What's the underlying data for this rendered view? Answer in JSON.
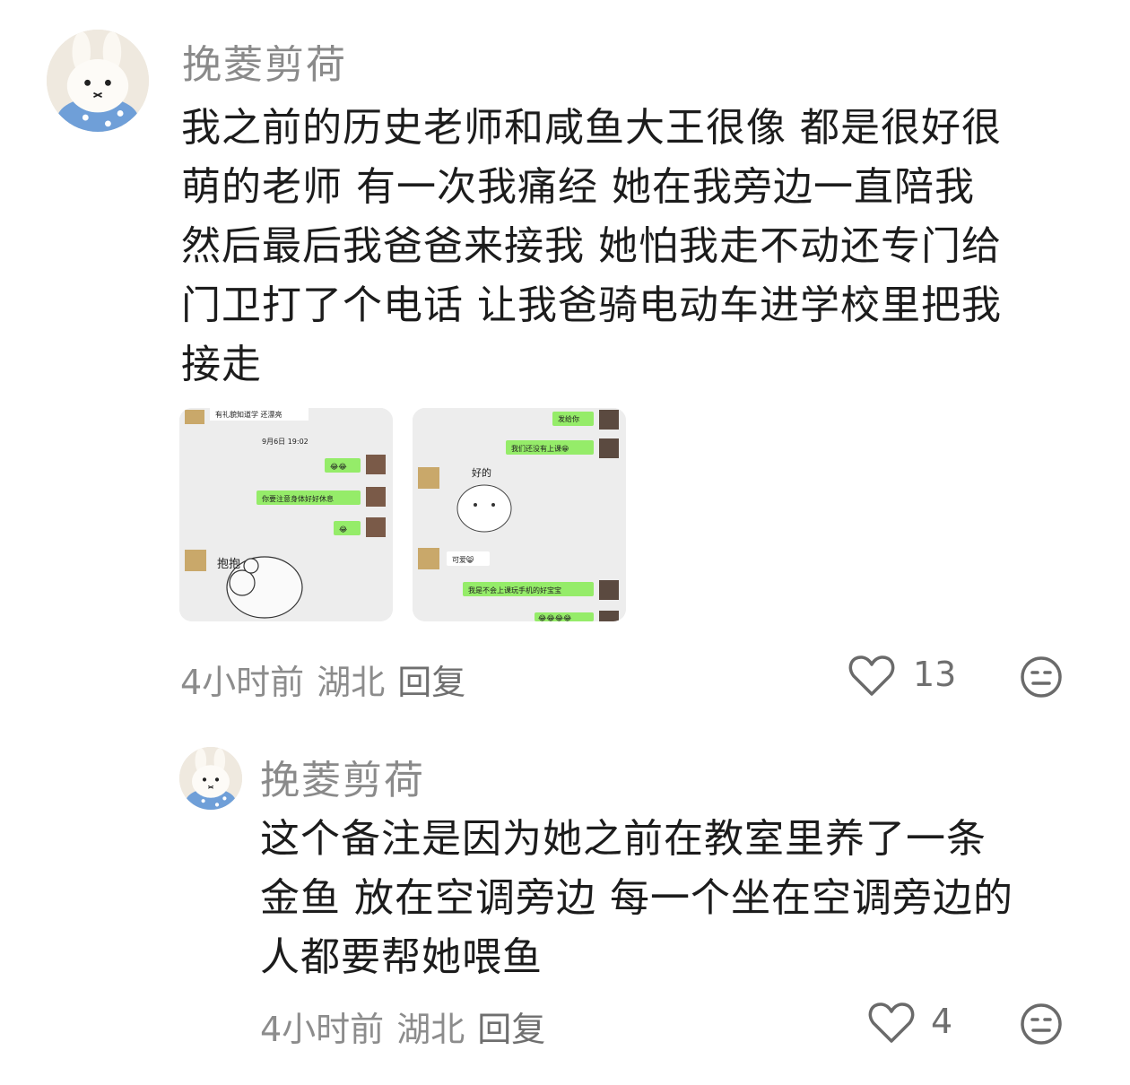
{
  "comments": [
    {
      "username": "挽菱剪荷",
      "lines": [
        "我之前的历史老师和咸鱼大王很像 都是很好很",
        "萌的老师 有一次我痛经 她在我旁边一直陪我",
        "然后最后我爸爸来接我 她怕我走不动还专门给",
        "门卫打了个电话 让我爸骑电动车进学校里把我",
        "接走"
      ],
      "time": "4小时前",
      "location": "湖北",
      "reply_label": "回复",
      "likes": "13",
      "images": [
        {
          "contact_name": "有礼貌知道学 还漂亮",
          "timestamp": "9月6日 19:02",
          "messages": [
            "😂😂",
            "你要注意身体好好休息",
            "😂"
          ],
          "sticker_text": "抱抱"
        },
        {
          "messages_top": [
            "发给你",
            "我们还没有上课😁"
          ],
          "sticker_text": "好的",
          "reply": "可爱😸",
          "messages_bottom": [
            "我是不会上课玩手机的好宝宝",
            "😂😂😂😂"
          ]
        }
      ]
    },
    {
      "username": "挽菱剪荷",
      "lines": [
        "这个备注是因为她之前在教室里养了一条",
        "金鱼 放在空调旁边 每一个坐在空调旁边的",
        "人都要帮她喂鱼"
      ],
      "time": "4小时前",
      "location": "湖北",
      "reply_label": "回复",
      "likes": "4"
    }
  ],
  "colors": {
    "username": "#8a8a8a",
    "meta": "#8c8c8c",
    "wechat_green": "#95ec69"
  }
}
